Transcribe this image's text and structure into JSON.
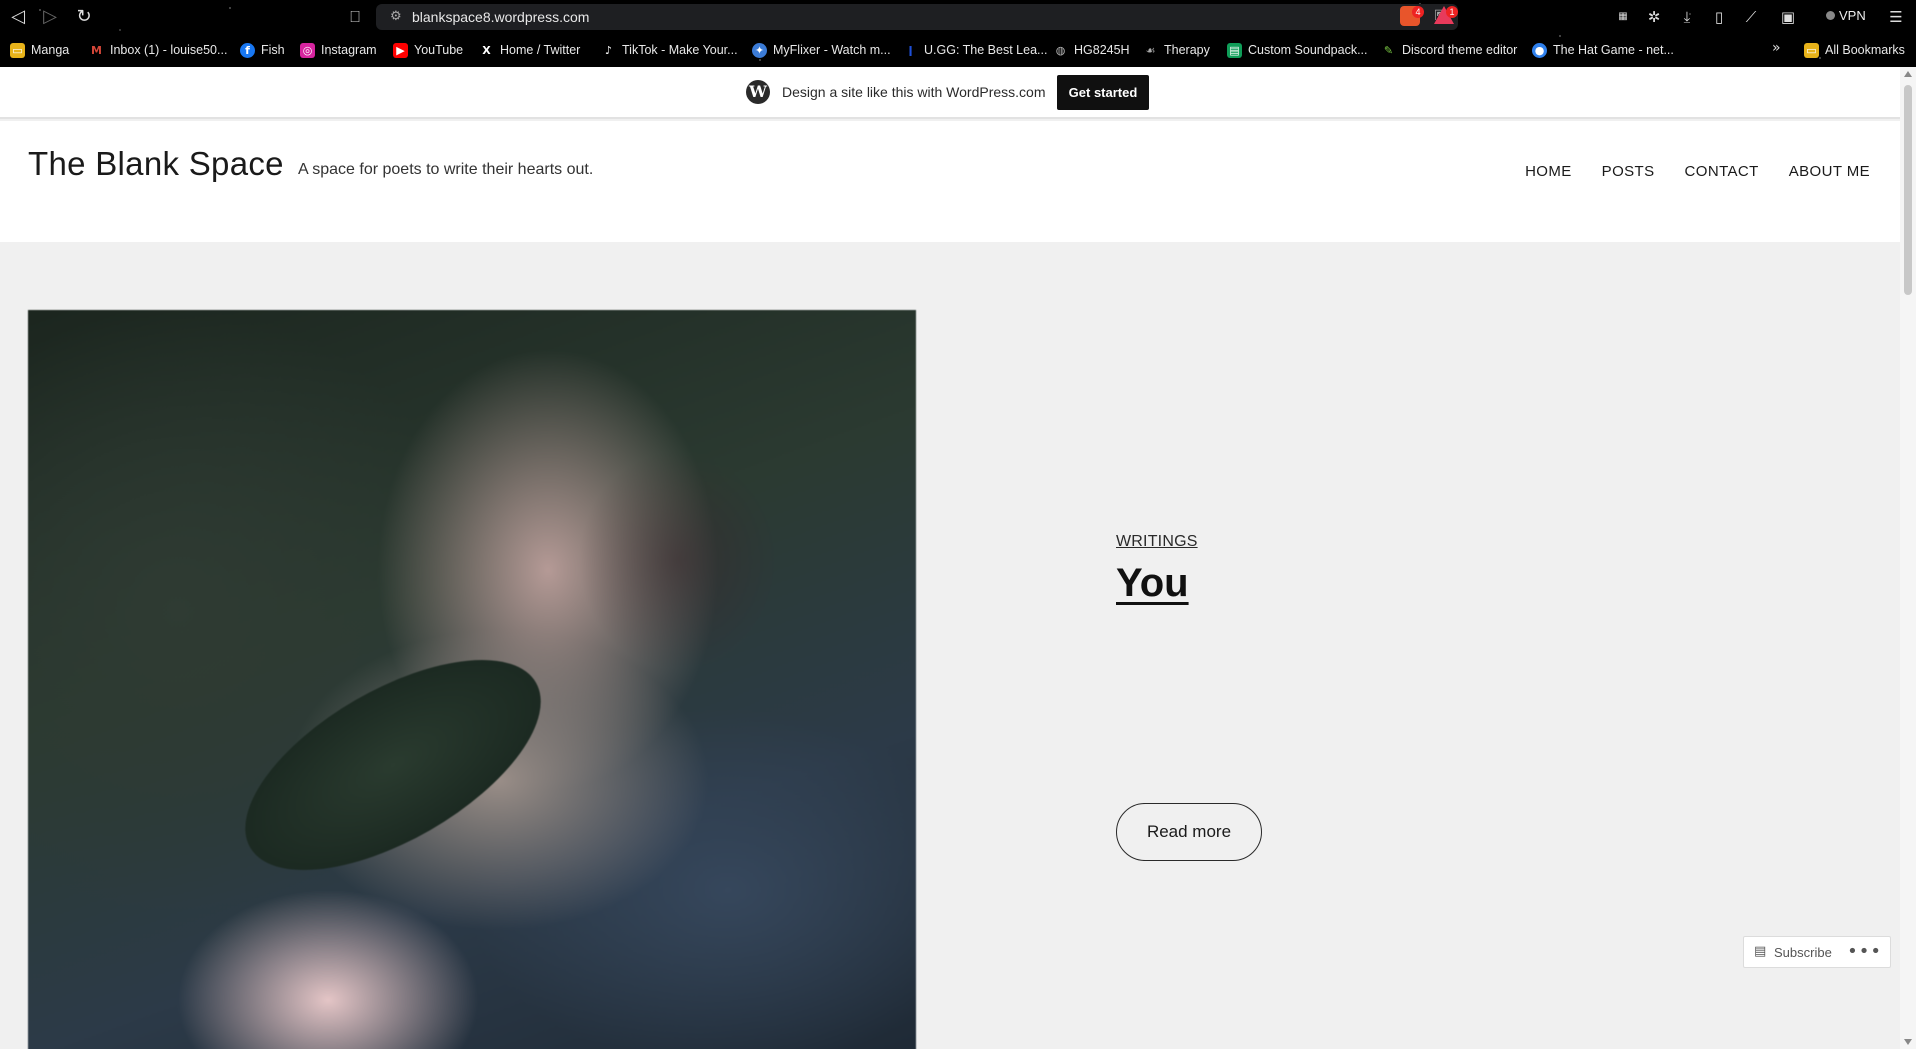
{
  "browser": {
    "url": "blankspace8.wordpress.com",
    "vpn_label": "VPN",
    "shield_badge": "4",
    "rewards_badge": "1",
    "bookmarks": [
      {
        "label": "Manga",
        "icon": "folder-icon",
        "color": "#e8b31a"
      },
      {
        "label": "Inbox (1) - louise50...",
        "icon": "gmail-icon",
        "color": "#d44638"
      },
      {
        "label": "Fish",
        "icon": "facebook-icon",
        "color": "#1877f2"
      },
      {
        "label": "Instagram",
        "icon": "instagram-icon",
        "color": "#d6249f"
      },
      {
        "label": "YouTube",
        "icon": "youtube-icon",
        "color": "#ff0000"
      },
      {
        "label": "Home / Twitter",
        "icon": "x-icon",
        "color": "#000000"
      },
      {
        "label": "TikTok - Make Your...",
        "icon": "tiktok-icon",
        "color": "#000000"
      },
      {
        "label": "MyFlixer - Watch m...",
        "icon": "myflixer-icon",
        "color": "#3b7bd6"
      },
      {
        "label": "U.GG: The Best Lea...",
        "icon": "ugg-icon",
        "color": "#1e4fd8"
      },
      {
        "label": "HG8245H",
        "icon": "globe-icon",
        "color": "#888888"
      },
      {
        "label": "Therapy",
        "icon": "therapy-icon",
        "color": "#777777"
      },
      {
        "label": "Custom Soundpack...",
        "icon": "sheets-icon",
        "color": "#0f9d58"
      },
      {
        "label": "Discord theme editor",
        "icon": "discord-theme-icon",
        "color": "#7ac943"
      },
      {
        "label": "The Hat Game - net...",
        "icon": "hatgame-icon",
        "color": "#2f80ed"
      }
    ],
    "all_bookmarks": "All Bookmarks"
  },
  "wp_banner": {
    "text": "Design a site like this with WordPress.com",
    "cta": "Get started"
  },
  "site": {
    "title": "The Blank Space",
    "tagline": "A space for poets to write their hearts out.",
    "nav": [
      "HOME",
      "POSTS",
      "CONTACT",
      "ABOUT ME"
    ]
  },
  "post": {
    "category": "WRITINGS",
    "title": "You",
    "read_more": "Read more"
  },
  "footer_bar": {
    "subscribe": "Subscribe",
    "more": "•••"
  }
}
